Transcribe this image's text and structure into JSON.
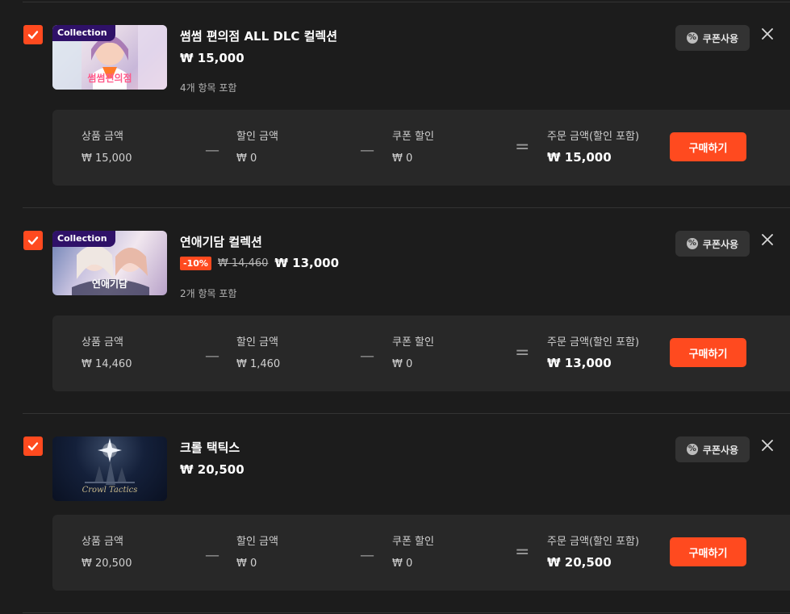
{
  "items": [
    {
      "tag": "Collection",
      "thumb_caption": "썸썸편의점",
      "title": "썸썸 편의점 ALL DLC 컬렉션",
      "price": "₩ 15,000",
      "included": "4개 항목 포함",
      "coupon_label": "쿠폰사용",
      "summary": {
        "product_label": "상품 금액",
        "product_value": "₩ 15,000",
        "discount_label": "할인 금액",
        "discount_value": "₩ 0",
        "coupon_label": "쿠폰 할인",
        "coupon_value": "₩ 0",
        "total_label": "주문 금액(할인 포함)",
        "total_value": "₩ 15,000",
        "buy_label": "구매하기"
      }
    },
    {
      "tag": "Collection",
      "thumb_caption": "연애기담",
      "title": "연애기담 컬렉션",
      "discount_badge": "-10%",
      "original_price": "₩ 14,460",
      "price": "₩ 13,000",
      "included": "2개 항목 포함",
      "coupon_label": "쿠폰사용",
      "summary": {
        "product_label": "상품 금액",
        "product_value": "₩ 14,460",
        "discount_label": "할인 금액",
        "discount_value": "₩ 1,460",
        "coupon_label": "쿠폰 할인",
        "coupon_value": "₩ 0",
        "total_label": "주문 금액(할인 포함)",
        "total_value": "₩ 13,000",
        "buy_label": "구매하기"
      }
    },
    {
      "thumb_caption": "Crowl Tactics",
      "title": "크롤 택틱스",
      "price": "₩ 20,500",
      "coupon_label": "쿠폰사용",
      "summary": {
        "product_label": "상품 금액",
        "product_value": "₩ 20,500",
        "discount_label": "할인 금액",
        "discount_value": "₩ 0",
        "coupon_label": "쿠폰 할인",
        "coupon_value": "₩ 0",
        "total_label": "주문 금액(할인 포함)",
        "total_value": "₩ 20,500",
        "buy_label": "구매하기"
      }
    }
  ],
  "operators": {
    "minus": "—",
    "equals": "="
  },
  "colors": {
    "accent": "#ff4a1f",
    "tag_bg": "#2f1168",
    "panel": "#282828",
    "background": "#1c1c1c"
  }
}
